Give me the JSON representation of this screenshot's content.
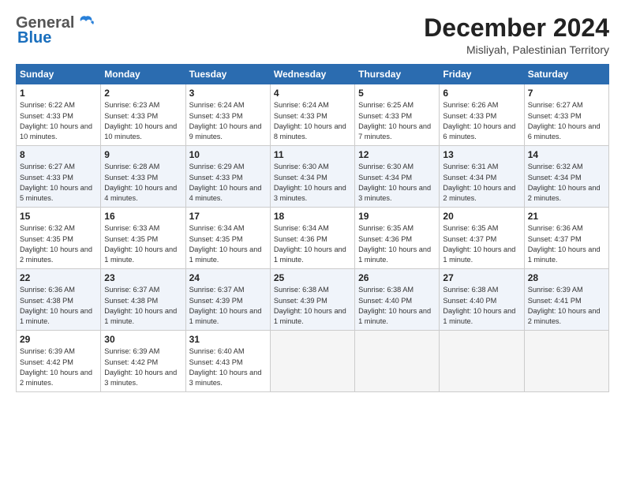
{
  "logo": {
    "general": "General",
    "blue": "Blue"
  },
  "title": "December 2024",
  "location": "Misliyah, Palestinian Territory",
  "days_header": [
    "Sunday",
    "Monday",
    "Tuesday",
    "Wednesday",
    "Thursday",
    "Friday",
    "Saturday"
  ],
  "weeks": [
    [
      {
        "day": "1",
        "sunrise": "6:22 AM",
        "sunset": "4:33 PM",
        "daylight": "10 hours and 10 minutes."
      },
      {
        "day": "2",
        "sunrise": "6:23 AM",
        "sunset": "4:33 PM",
        "daylight": "10 hours and 10 minutes."
      },
      {
        "day": "3",
        "sunrise": "6:24 AM",
        "sunset": "4:33 PM",
        "daylight": "10 hours and 9 minutes."
      },
      {
        "day": "4",
        "sunrise": "6:24 AM",
        "sunset": "4:33 PM",
        "daylight": "10 hours and 8 minutes."
      },
      {
        "day": "5",
        "sunrise": "6:25 AM",
        "sunset": "4:33 PM",
        "daylight": "10 hours and 7 minutes."
      },
      {
        "day": "6",
        "sunrise": "6:26 AM",
        "sunset": "4:33 PM",
        "daylight": "10 hours and 6 minutes."
      },
      {
        "day": "7",
        "sunrise": "6:27 AM",
        "sunset": "4:33 PM",
        "daylight": "10 hours and 6 minutes."
      }
    ],
    [
      {
        "day": "8",
        "sunrise": "6:27 AM",
        "sunset": "4:33 PM",
        "daylight": "10 hours and 5 minutes."
      },
      {
        "day": "9",
        "sunrise": "6:28 AM",
        "sunset": "4:33 PM",
        "daylight": "10 hours and 4 minutes."
      },
      {
        "day": "10",
        "sunrise": "6:29 AM",
        "sunset": "4:33 PM",
        "daylight": "10 hours and 4 minutes."
      },
      {
        "day": "11",
        "sunrise": "6:30 AM",
        "sunset": "4:34 PM",
        "daylight": "10 hours and 3 minutes."
      },
      {
        "day": "12",
        "sunrise": "6:30 AM",
        "sunset": "4:34 PM",
        "daylight": "10 hours and 3 minutes."
      },
      {
        "day": "13",
        "sunrise": "6:31 AM",
        "sunset": "4:34 PM",
        "daylight": "10 hours and 2 minutes."
      },
      {
        "day": "14",
        "sunrise": "6:32 AM",
        "sunset": "4:34 PM",
        "daylight": "10 hours and 2 minutes."
      }
    ],
    [
      {
        "day": "15",
        "sunrise": "6:32 AM",
        "sunset": "4:35 PM",
        "daylight": "10 hours and 2 minutes."
      },
      {
        "day": "16",
        "sunrise": "6:33 AM",
        "sunset": "4:35 PM",
        "daylight": "10 hours and 1 minute."
      },
      {
        "day": "17",
        "sunrise": "6:34 AM",
        "sunset": "4:35 PM",
        "daylight": "10 hours and 1 minute."
      },
      {
        "day": "18",
        "sunrise": "6:34 AM",
        "sunset": "4:36 PM",
        "daylight": "10 hours and 1 minute."
      },
      {
        "day": "19",
        "sunrise": "6:35 AM",
        "sunset": "4:36 PM",
        "daylight": "10 hours and 1 minute."
      },
      {
        "day": "20",
        "sunrise": "6:35 AM",
        "sunset": "4:37 PM",
        "daylight": "10 hours and 1 minute."
      },
      {
        "day": "21",
        "sunrise": "6:36 AM",
        "sunset": "4:37 PM",
        "daylight": "10 hours and 1 minute."
      }
    ],
    [
      {
        "day": "22",
        "sunrise": "6:36 AM",
        "sunset": "4:38 PM",
        "daylight": "10 hours and 1 minute."
      },
      {
        "day": "23",
        "sunrise": "6:37 AM",
        "sunset": "4:38 PM",
        "daylight": "10 hours and 1 minute."
      },
      {
        "day": "24",
        "sunrise": "6:37 AM",
        "sunset": "4:39 PM",
        "daylight": "10 hours and 1 minute."
      },
      {
        "day": "25",
        "sunrise": "6:38 AM",
        "sunset": "4:39 PM",
        "daylight": "10 hours and 1 minute."
      },
      {
        "day": "26",
        "sunrise": "6:38 AM",
        "sunset": "4:40 PM",
        "daylight": "10 hours and 1 minute."
      },
      {
        "day": "27",
        "sunrise": "6:38 AM",
        "sunset": "4:40 PM",
        "daylight": "10 hours and 1 minute."
      },
      {
        "day": "28",
        "sunrise": "6:39 AM",
        "sunset": "4:41 PM",
        "daylight": "10 hours and 2 minutes."
      }
    ],
    [
      {
        "day": "29",
        "sunrise": "6:39 AM",
        "sunset": "4:42 PM",
        "daylight": "10 hours and 2 minutes."
      },
      {
        "day": "30",
        "sunrise": "6:39 AM",
        "sunset": "4:42 PM",
        "daylight": "10 hours and 3 minutes."
      },
      {
        "day": "31",
        "sunrise": "6:40 AM",
        "sunset": "4:43 PM",
        "daylight": "10 hours and 3 minutes."
      },
      null,
      null,
      null,
      null
    ]
  ]
}
